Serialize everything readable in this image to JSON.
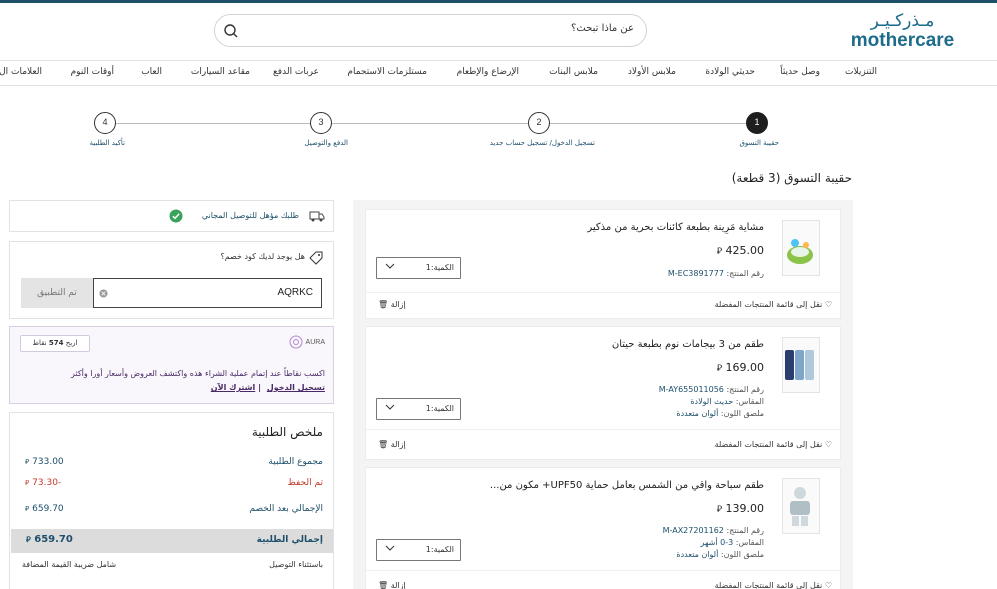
{
  "header": {
    "logo_arabic": "مـذركـيـر",
    "logo_english": "mothercare",
    "search_placeholder": "عن ماذا تبحث؟"
  },
  "nav": [
    "التنزيلات",
    "وصل حديثاً",
    "حديثي الولادة",
    "ملابس الأولاد",
    "ملابس البنات",
    "الإرضاع والإطعام",
    "مستلزمات الاستحمام",
    "عربات الدفع",
    "مقاعد السيارات",
    "العاب",
    "أوقات النوم",
    "العلامات ال"
  ],
  "steps": [
    {
      "num": "1",
      "label": "حقيبة التسوق"
    },
    {
      "num": "2",
      "label": "تسجيل الدخول/ تسجيل حساب جديد"
    },
    {
      "num": "3",
      "label": "الدفع والتوصيل"
    },
    {
      "num": "4",
      "label": "تأكيد الطلبية"
    }
  ],
  "page_title": "حقيبة التسوق (3 قطعة)",
  "currency": "⃁",
  "items": [
    {
      "name": "مشاية مَرِينة بطبعة كائنات بحرية من مذكير",
      "price": "425.00",
      "code_label": "رقم المنتج",
      "code": "M-EC3891777",
      "size_label": "",
      "size": "",
      "color_label": "",
      "color": "",
      "qty": "الكمية:1",
      "wishlist": "نقل إلى قائمة المنتجات المفضلة",
      "remove": "إزالة"
    },
    {
      "name": "طقم من 3 بيجامات نوم بطبعة حيتان",
      "price": "169.00",
      "code_label": "رقم المنتج",
      "code": "M-AY655011056",
      "size_label": "المقاس",
      "size": "حديث الولادة",
      "color_label": "ملصق اللون",
      "color": "ألوان متعددة",
      "qty": "الكمية:1",
      "wishlist": "نقل إلى قائمة المنتجات المفضلة",
      "remove": "إزالة"
    },
    {
      "name": "طقم سباحة واقي من الشمس بعامل حماية UPF50+ مكون من...",
      "price": "139.00",
      "code_label": "رقم المنتج",
      "code": "M-AX27201162",
      "size_label": "المقاس",
      "size": "3-0 أشهر",
      "color_label": "ملصق اللون",
      "color": "ألوان متعددة",
      "qty": "الكمية:1",
      "wishlist": "نقل إلى قائمة المنتجات المفضلة",
      "remove": "إزالة"
    }
  ],
  "free_shipping": "طلبك مؤهل للتوصيل المجاني",
  "promo": {
    "question": "هل يوجد لديك كود خصم؟",
    "code": "AQRKC",
    "applied": "تم التطبيق"
  },
  "aura": {
    "logo": "AURA",
    "badge_prefix": "اربح",
    "badge_points": "574",
    "badge_suffix": "نقاط",
    "text": "اكسب نقاطاً عند إتمام عملية الشراء هذه واكتشف العروض وأسعار أورا وأكثر",
    "login": "تسجيل الدخول",
    "join": "اشترك الآن"
  },
  "summary": {
    "title": "ملخص الطلبية",
    "subtotal_label": "مجموع الطلبية",
    "subtotal": "733.00",
    "discount_label": "تم الحفظ",
    "discount": "-73.30",
    "after_discount_label": "الإجمالي بعد الخصم",
    "after_discount": "659.70",
    "total_label": "إجمالي الطلبية",
    "total": "659.70",
    "excl_delivery": "باستثناء التوصيل",
    "incl_vat": "شامل ضريبة القيمة المضافة"
  }
}
